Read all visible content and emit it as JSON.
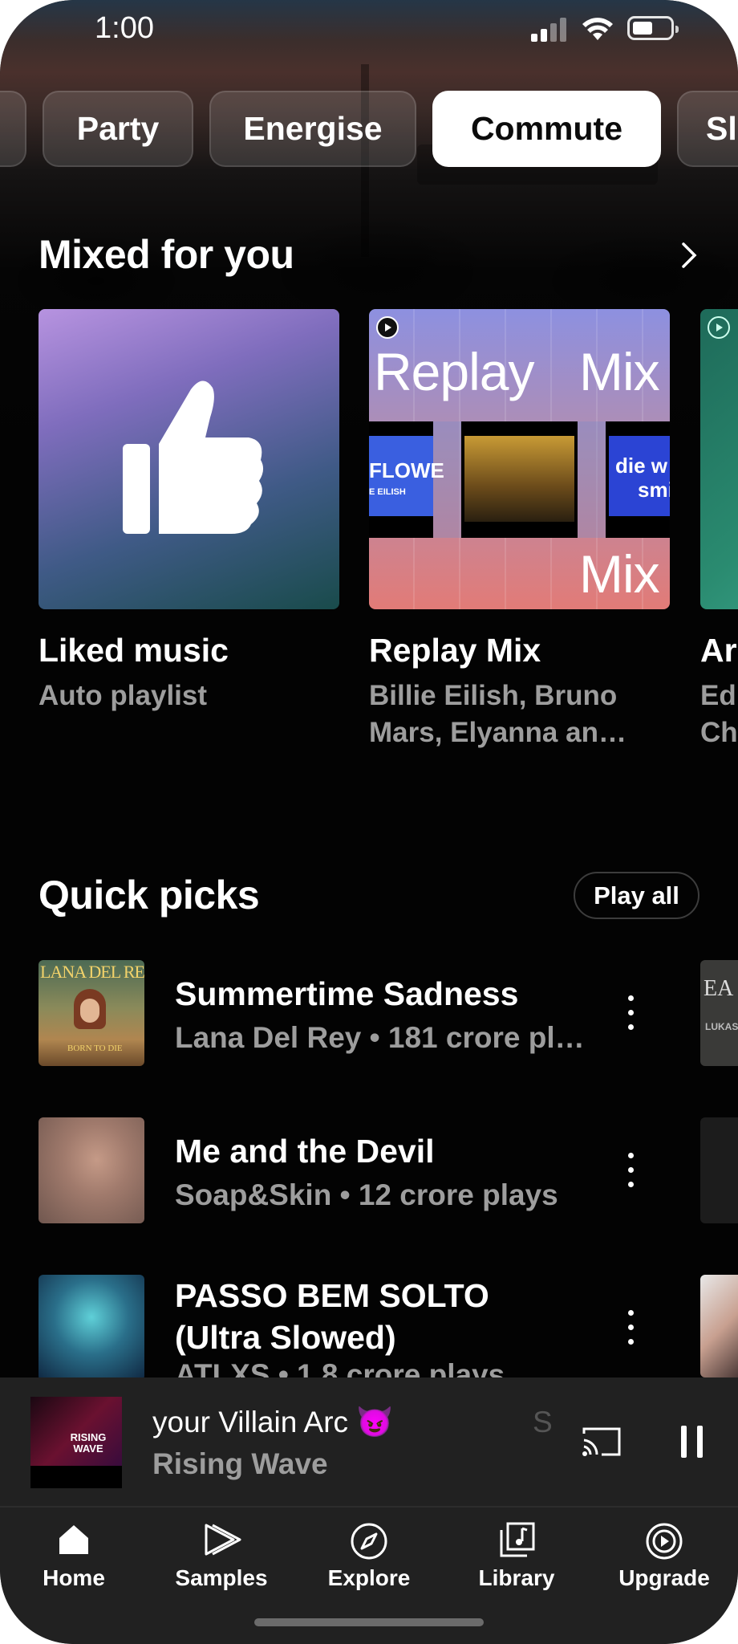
{
  "status_bar": {
    "time": "1:00"
  },
  "chips": [
    "Party",
    "Energise",
    "Commute",
    "Sl"
  ],
  "active_chip": "Commute",
  "mixed_for_you": {
    "title": "Mixed for you",
    "cards": [
      {
        "title": "Liked music",
        "subtitle": "Auto playlist"
      },
      {
        "title": "Replay Mix",
        "subtitle": "Billie Eilish, Bruno Mars, Elyanna an…",
        "art_text_top_left": "Replay",
        "art_text_top_right": "Mix",
        "art_text_bottom": "Mix",
        "art_label_left": "FLOWE",
        "art_label_left_sub": "E EILISH",
        "art_label_right": "die w",
        "art_label_right_2": "smi"
      },
      {
        "title": "Ar",
        "subtitle": "Ed Ch"
      }
    ]
  },
  "quick_picks": {
    "title": "Quick picks",
    "play_all": "Play all",
    "rows": [
      {
        "title": "Summertime Sadness",
        "subtitle": "Lana Del Rey • 181 crore pl…",
        "art_text": "LANA DEL REY",
        "art_subtext": "BORN TO DIE"
      },
      {
        "title": "Me and the Devil",
        "subtitle": "Soap&Skin • 12 crore plays"
      },
      {
        "title": "PASSO BEM SOLTO",
        "title_line2": "(Ultra Slowed)",
        "subtitle": "ATLXS • 1.8 crore plays"
      }
    ],
    "peek_labels": [
      "EA",
      "LUKAS"
    ]
  },
  "mini_player": {
    "song": "your Villain Arc 😈",
    "artist": "Rising Wave",
    "ghost_text": "S",
    "art_text": "RISING WAVE"
  },
  "bottom_nav": [
    {
      "label": "Home",
      "icon": "home-icon",
      "active": true
    },
    {
      "label": "Samples",
      "icon": "samples-icon"
    },
    {
      "label": "Explore",
      "icon": "explore-icon"
    },
    {
      "label": "Library",
      "icon": "library-icon"
    },
    {
      "label": "Upgrade",
      "icon": "upgrade-icon"
    }
  ],
  "colors": {
    "background": "#030303",
    "secondary_text": "#9d9d9d",
    "panel": "#212121",
    "active_chip": "#ffffff"
  }
}
